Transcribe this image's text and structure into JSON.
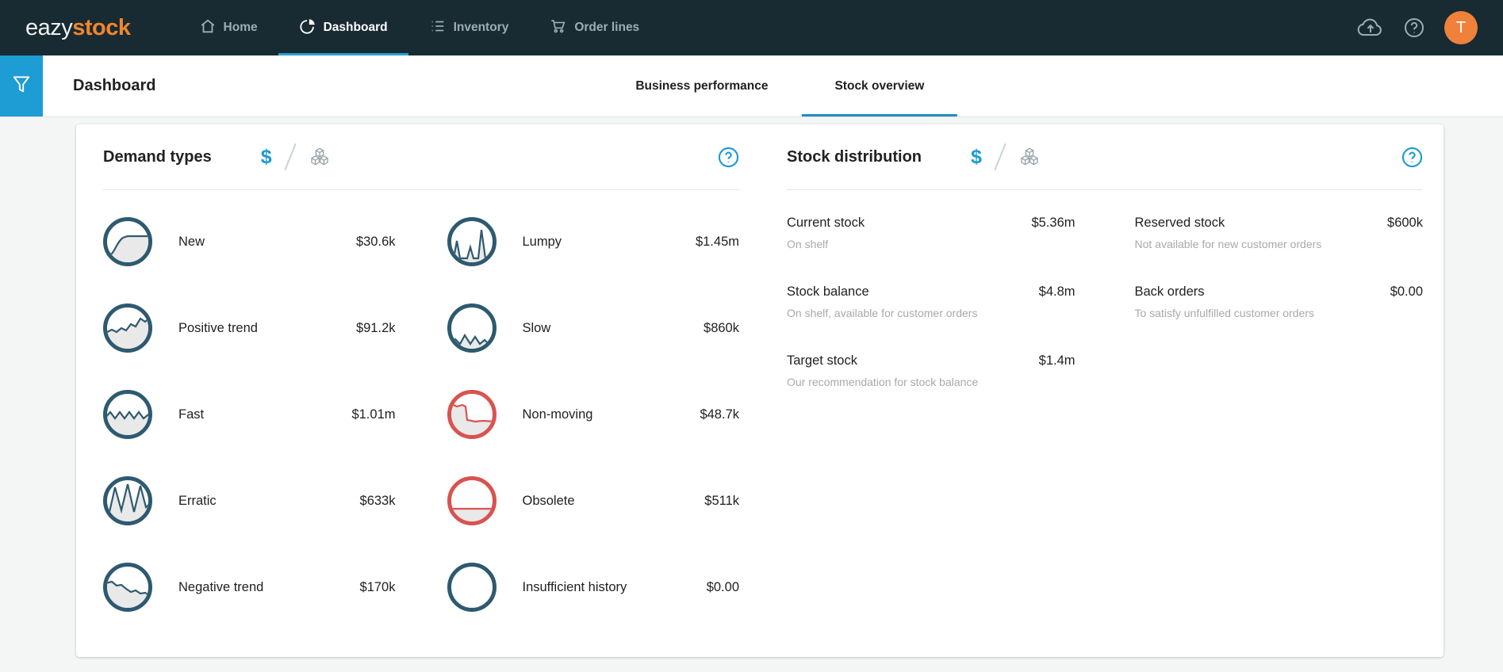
{
  "brand": {
    "light": "eazy",
    "bold": "stock"
  },
  "nav": {
    "items": [
      {
        "label": "Home",
        "active": false
      },
      {
        "label": "Dashboard",
        "active": true
      },
      {
        "label": "Inventory",
        "active": false
      },
      {
        "label": "Order lines",
        "active": false
      }
    ],
    "avatar_letter": "T"
  },
  "header": {
    "title": "Dashboard",
    "tabs": [
      {
        "label": "Business performance",
        "active": false
      },
      {
        "label": "Stock overview",
        "active": true
      }
    ]
  },
  "unit_toggle": {
    "value_label": "$"
  },
  "demand": {
    "title": "Demand types",
    "items": [
      {
        "label": "New",
        "value": "$30.6k"
      },
      {
        "label": "Lumpy",
        "value": "$1.45m"
      },
      {
        "label": "Positive trend",
        "value": "$91.2k"
      },
      {
        "label": "Slow",
        "value": "$860k"
      },
      {
        "label": "Fast",
        "value": "$1.01m"
      },
      {
        "label": "Non-moving",
        "value": "$48.7k"
      },
      {
        "label": "Erratic",
        "value": "$633k"
      },
      {
        "label": "Obsolete",
        "value": "$511k"
      },
      {
        "label": "Negative trend",
        "value": "$170k"
      },
      {
        "label": "Insufficient history",
        "value": "$0.00"
      }
    ]
  },
  "stock": {
    "title": "Stock distribution",
    "stats": [
      {
        "label": "Current stock",
        "value": "$5.36m",
        "description": "On shelf"
      },
      {
        "label": "Reserved stock",
        "value": "$600k",
        "description": "Not available for new customer orders"
      },
      {
        "label": "Stock balance",
        "value": "$4.8m",
        "description": "On shelf, available for customer orders"
      },
      {
        "label": "Back orders",
        "value": "$0.00",
        "description": "To satisfy unfulfilled customer orders"
      },
      {
        "label": "Target stock",
        "value": "$1.4m",
        "description": "Our recommendation for stock balance"
      }
    ]
  },
  "colors": {
    "accent_blue": "#1b9bd3",
    "nav_bg": "#182a32",
    "brand_orange": "#f0862d",
    "demand_teal": "#2e5a70",
    "demand_red": "#d85350",
    "avatar_orange": "#f0813a"
  }
}
